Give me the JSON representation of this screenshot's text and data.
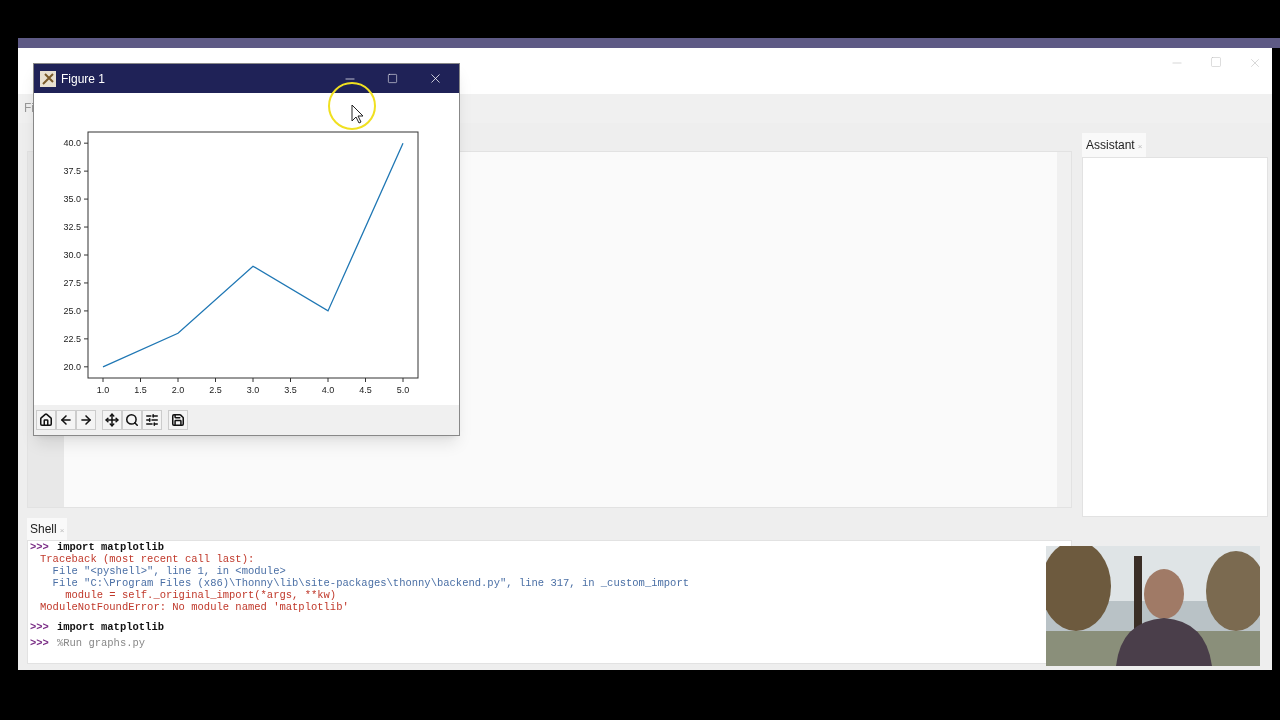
{
  "main_window": {
    "menu": [
      "Fi"
    ]
  },
  "assistant": {
    "tab": {
      "label": "Assistant",
      "close": "×"
    }
  },
  "shell": {
    "tab": {
      "label": "Shell",
      "close": "×"
    },
    "prompt": ">>>",
    "lines": [
      {
        "kind": "command",
        "text": "import matplotlib"
      },
      {
        "kind": "error",
        "text": "Traceback (most recent call last):"
      },
      {
        "kind": "link",
        "text": "  File \"<pyshell>\", line 1, in <module>"
      },
      {
        "kind": "link",
        "text": "  File \"C:\\Program Files (x86)\\Thonny\\lib\\site-packages\\thonny\\backend.py\", line 317, in _custom_import"
      },
      {
        "kind": "error",
        "text": "    module = self._original_import(*args, **kw)"
      },
      {
        "kind": "error",
        "text": "ModuleNotFoundError: No module named 'matplotlib'"
      },
      {
        "kind": "command",
        "text": "import matplotlib"
      },
      {
        "kind": "magic",
        "text": "%Run graphs.py"
      }
    ]
  },
  "figure_window": {
    "title": "Figure 1",
    "chart_data": {
      "type": "line",
      "x": [
        1,
        2,
        3,
        4,
        5
      ],
      "series": [
        {
          "color": "#1f77b4",
          "values": [
            20,
            23,
            29,
            25,
            40
          ]
        }
      ],
      "xlim": [
        0.8,
        5.2
      ],
      "ylim": [
        19.0,
        41.0
      ],
      "xticks": [
        {
          "value": 1,
          "label": "1.0"
        },
        {
          "value": 1.5,
          "label": "1.5"
        },
        {
          "value": 2,
          "label": "2.0"
        },
        {
          "value": 2.5,
          "label": "2.5"
        },
        {
          "value": 3,
          "label": "3.0"
        },
        {
          "value": 3.5,
          "label": "3.5"
        },
        {
          "value": 4,
          "label": "4.0"
        },
        {
          "value": 4.5,
          "label": "4.5"
        },
        {
          "value": 5,
          "label": "5.0"
        }
      ],
      "yticks": [
        {
          "value": 20,
          "label": "20.0"
        },
        {
          "value": 22.5,
          "label": "22.5"
        },
        {
          "value": 25,
          "label": "25.0"
        },
        {
          "value": 27.5,
          "label": "27.5"
        },
        {
          "value": 30,
          "label": "30.0"
        },
        {
          "value": 32.5,
          "label": "32.5"
        },
        {
          "value": 35,
          "label": "35.0"
        },
        {
          "value": 37.5,
          "label": "37.5"
        },
        {
          "value": 40,
          "label": "40.0"
        }
      ]
    },
    "toolbar": [
      {
        "kind": "home"
      },
      {
        "kind": "back"
      },
      {
        "kind": "forward"
      },
      {
        "kind": "gap"
      },
      {
        "kind": "pan"
      },
      {
        "kind": "zoom"
      },
      {
        "kind": "configure"
      },
      {
        "kind": "gap"
      },
      {
        "kind": "save"
      }
    ]
  }
}
